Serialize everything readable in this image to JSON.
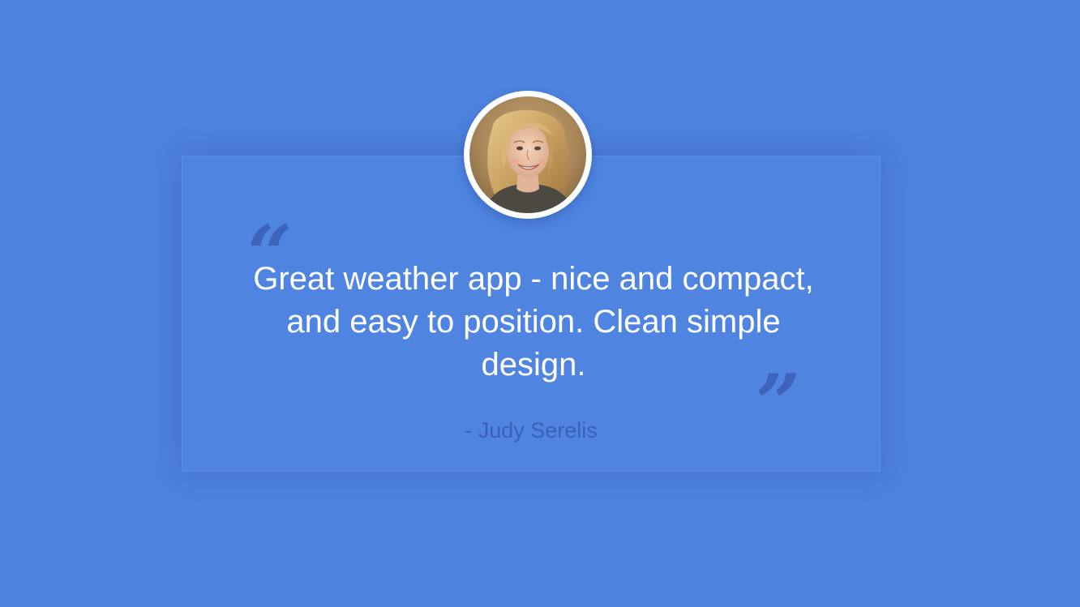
{
  "testimonial": {
    "quote_open": "“",
    "quote_text": "Great weather app - nice and compact, and easy to position. Clean simple design.",
    "quote_close": "”",
    "author": "- Judy Serelis"
  },
  "avatar": {
    "icon": "profile-photo"
  },
  "colors": {
    "background": "#4e84e0",
    "card": "#4f84e1",
    "quote_marks": "#3b5fb4",
    "author_text": "#3a61b6",
    "quote_text": "#ffffff"
  }
}
